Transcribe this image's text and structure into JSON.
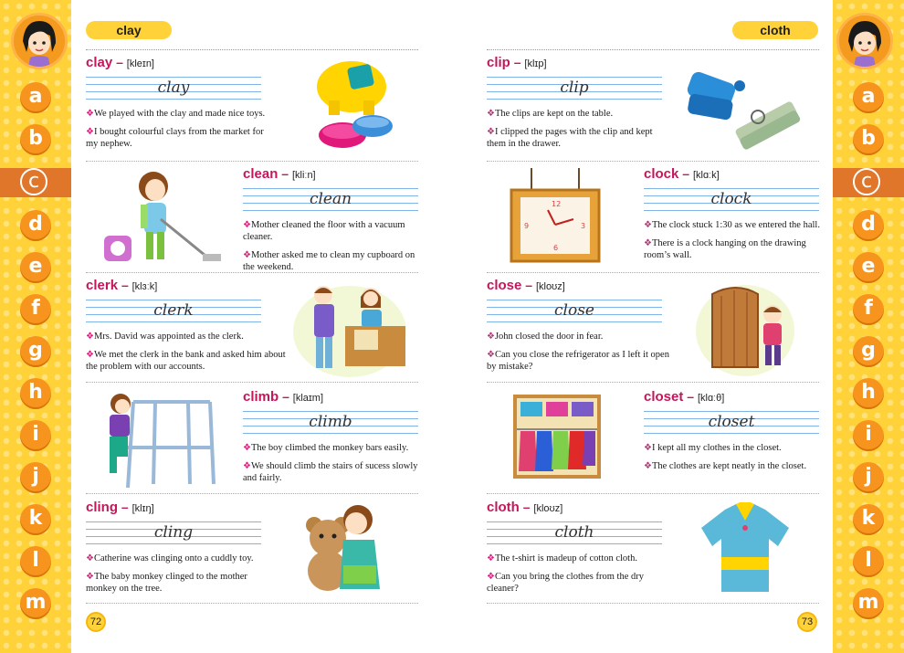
{
  "header": {
    "left_guide": "clay",
    "right_guide": "cloth"
  },
  "alphabet": [
    "a",
    "b",
    "c",
    "d",
    "e",
    "f",
    "g",
    "h",
    "i",
    "j",
    "k",
    "l",
    "m"
  ],
  "active_letter": "c",
  "accent": "#c2185b",
  "strip_color": "#ffd23a",
  "letter_color": "#f7941d",
  "left_entries": [
    {
      "word": "clay",
      "pron": "[kleɪn]",
      "cursive": "clay",
      "sentences": [
        "We played with the clay and made nice toys.",
        "I bought colourful clays from the market for my nephew."
      ]
    },
    {
      "word": "clean",
      "pron": "[kliːn]",
      "cursive": "clean",
      "sentences": [
        "Mother cleaned the floor with a vacuum cleaner.",
        "Mother asked me to clean my cupboard on the weekend."
      ]
    },
    {
      "word": "clerk",
      "pron": "[klɜːk]",
      "cursive": "clerk",
      "sentences": [
        "Mrs. David was appointed as the clerk.",
        "We met the clerk in the bank and asked him about the problem with our accounts."
      ]
    },
    {
      "word": "climb",
      "pron": "[klaɪm]",
      "cursive": "climb",
      "sentences": [
        "The boy climbed the monkey bars easily.",
        "We should climb the stairs of sucess slowly and fairly."
      ]
    },
    {
      "word": "cling",
      "pron": "[klɪŋ]",
      "cursive": "cling",
      "sentences": [
        "Catherine was clinging onto a cuddly toy.",
        "The baby monkey clinged to the mother monkey on the tree."
      ]
    }
  ],
  "right_entries": [
    {
      "word": "clip",
      "pron": "[klɪp]",
      "cursive": "clip",
      "sentences": [
        "The clips are kept on the table.",
        "I clipped the pages with the clip and kept them in the drawer."
      ]
    },
    {
      "word": "clock",
      "pron": "[klɑːk]",
      "cursive": "clock",
      "sentences": [
        "The clock stuck 1:30 as we entered the hall.",
        "There is a clock hanging on the drawing room’s wall."
      ]
    },
    {
      "word": "close",
      "pron": "[kloʊz]",
      "cursive": "close",
      "sentences": [
        "John closed the door in fear.",
        "Can you close the refrigerator as I left it open by mistake?"
      ]
    },
    {
      "word": "closet",
      "pron": "[klɑːθ]",
      "cursive": "closet",
      "sentences": [
        "I kept all my clothes in the closet.",
        "The clothes are kept neatly in the closet."
      ]
    },
    {
      "word": "cloth",
      "pron": "[kloʊz]",
      "cursive": "cloth",
      "sentences": [
        "The t-shirt is madeup of cotton cloth.",
        "Can you bring the clothes from the dry cleaner?"
      ]
    }
  ],
  "page_numbers": {
    "left": "72",
    "right": "73"
  },
  "bullet_glyph": "❖",
  "dash_glyph": "–"
}
